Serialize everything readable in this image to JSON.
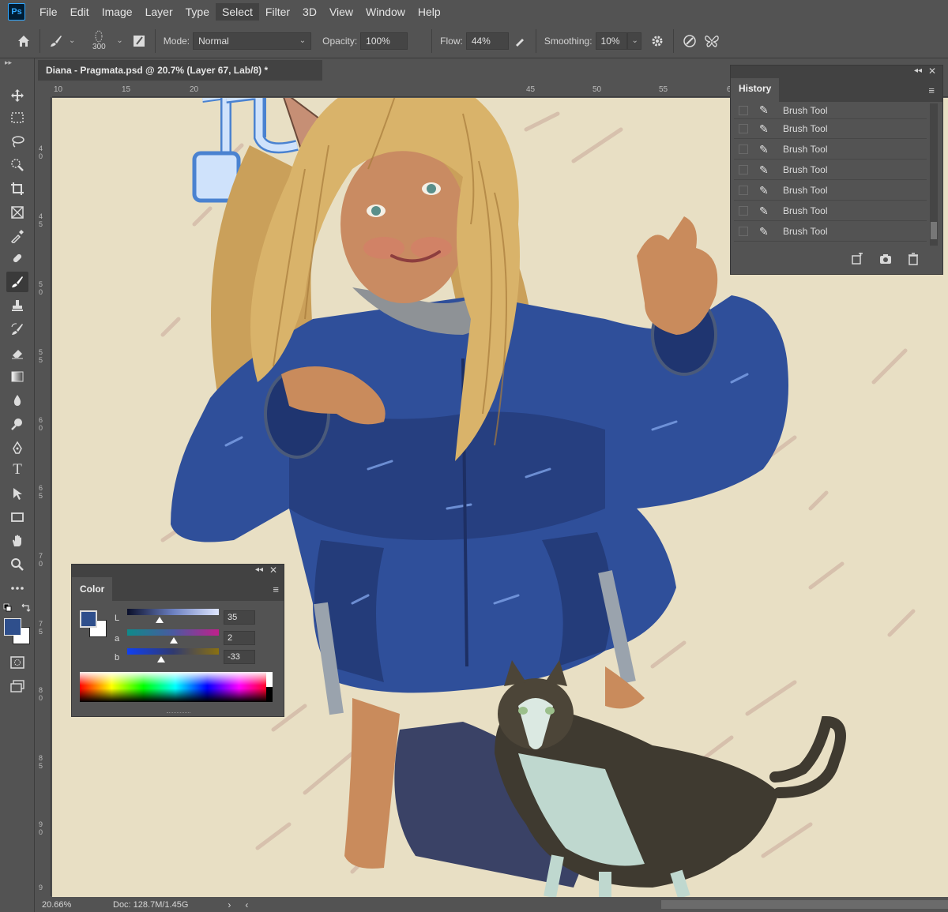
{
  "app": {
    "logo": "Ps"
  },
  "menu": [
    "File",
    "Edit",
    "Image",
    "Layer",
    "Type",
    "Select",
    "Filter",
    "3D",
    "View",
    "Window",
    "Help"
  ],
  "options": {
    "brush_size": "300",
    "mode_label": "Mode:",
    "mode_value": "Normal",
    "opacity_label": "Opacity:",
    "opacity_value": "100%",
    "flow_label": "Flow:",
    "flow_value": "44%",
    "smoothing_label": "Smoothing:",
    "smoothing_value": "10%"
  },
  "document": {
    "tab_title": "Diana - Pragmata.psd @ 20.7% (Layer 67, Lab/8) *"
  },
  "ruler_top": [
    "10",
    "15",
    "20",
    "45",
    "50",
    "55",
    "6"
  ],
  "ruler_left": [
    "4 0",
    "4 5",
    "5 0",
    "5 5",
    "6 0",
    "6 5",
    "7 0",
    "7 5",
    "8 0",
    "8 5",
    "9 0",
    "9"
  ],
  "history": {
    "title": "History",
    "items": [
      "Brush Tool",
      "Brush Tool",
      "Brush Tool",
      "Brush Tool",
      "Brush Tool",
      "Brush Tool",
      "Brush Tool"
    ]
  },
  "color_panel": {
    "title": "Color",
    "L_label": "L",
    "a_label": "a",
    "b_label": "b",
    "L_value": "35",
    "a_value": "2",
    "b_value": "-33",
    "foreground": "#2f4f8c",
    "background": "#ffffff"
  },
  "status": {
    "zoom": "20.66%",
    "doc_size": "Doc: 128.7M/1.45G"
  },
  "colors": {
    "ui_bg": "#535353",
    "canvas": "#e8dfc4",
    "jacket": "#2f4f9a",
    "hair": "#d9b36a"
  }
}
